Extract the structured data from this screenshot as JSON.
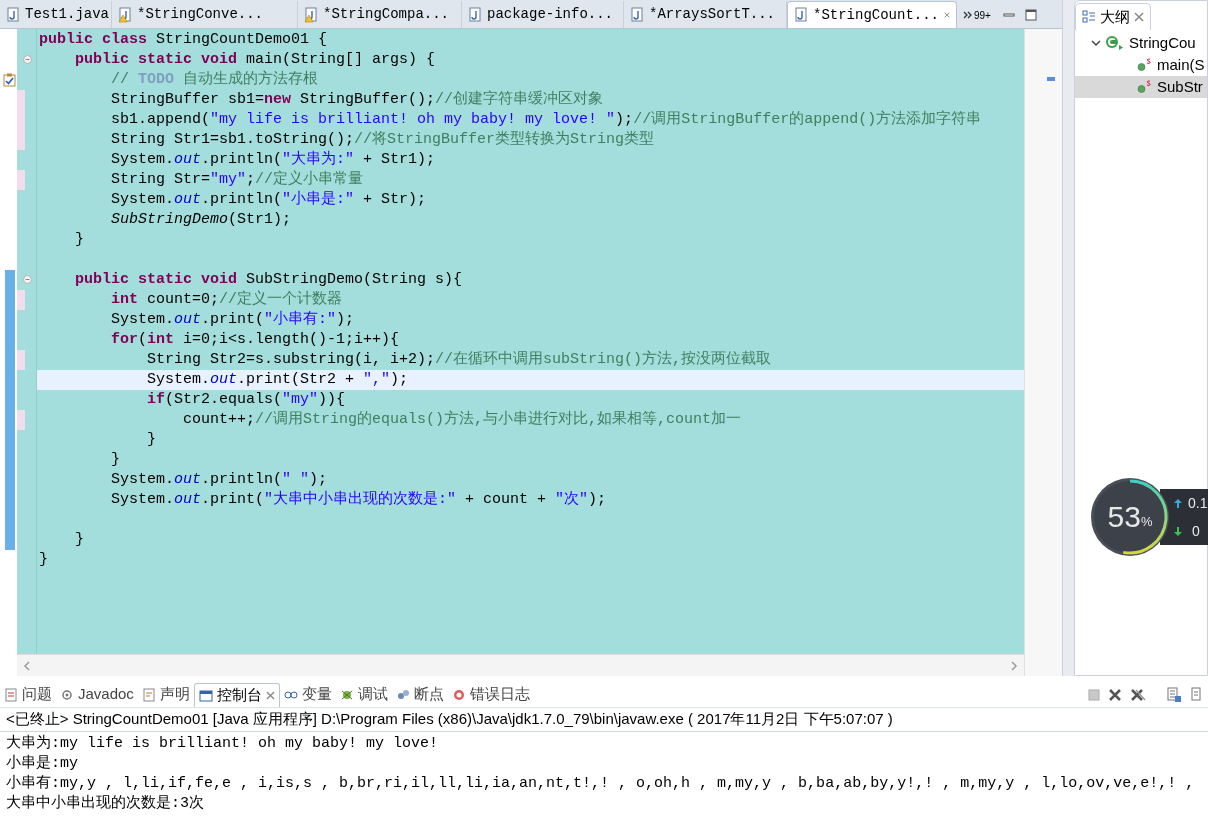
{
  "editor": {
    "tabs": [
      {
        "label": "Test1.java",
        "selected": false,
        "warning": false
      },
      {
        "label": "*StringConve...",
        "selected": false,
        "warning": true
      },
      {
        "label": "*StringCompa...",
        "selected": false,
        "warning": true
      },
      {
        "label": "package-info...",
        "selected": false,
        "warning": false
      },
      {
        "label": "*ArraysSortT...",
        "selected": false,
        "warning": false
      },
      {
        "label": "*StringCount...",
        "selected": true,
        "warning": false
      }
    ],
    "overflow_count": "99+",
    "lines": [
      {
        "tokens": [
          {
            "kind": "keyword",
            "text": "public class"
          },
          {
            "kind": "plain",
            "text": " StringCountDemo01 {"
          }
        ],
        "changed": false,
        "foldable": false,
        "task": false,
        "in_range": false,
        "current": false,
        "children": [
          {
            "tokens": [
              {
                "kind": "keyword",
                "text": "public static void"
              },
              {
                "kind": "plain",
                "text": " main(String[] args) {"
              }
            ],
            "changed": false,
            "foldable": true,
            "task": false,
            "in_range": false,
            "current": false,
            "children": [
              {
                "tokens": [
                  {
                    "kind": "comment",
                    "text": "// "
                  },
                  {
                    "kind": "task_tag",
                    "text": "TODO"
                  },
                  {
                    "kind": "comment",
                    "text": " 自动生成的方法存根"
                  }
                ],
                "changed": false,
                "foldable": false,
                "task": true,
                "in_range": false,
                "current": false
              },
              {
                "tokens": [
                  {
                    "kind": "plain",
                    "text": "StringBuffer sb1="
                  },
                  {
                    "kind": "keyword",
                    "text": "new"
                  },
                  {
                    "kind": "plain",
                    "text": " StringBuffer();"
                  },
                  {
                    "kind": "comment",
                    "text": "//创建字符串缓冲区对象"
                  }
                ],
                "changed": true,
                "foldable": false,
                "task": false,
                "in_range": false,
                "current": false
              },
              {
                "tokens": [
                  {
                    "kind": "plain",
                    "text": "sb1.append("
                  },
                  {
                    "kind": "string",
                    "text": "\"my life is brilliant! oh my baby! my love! \""
                  },
                  {
                    "kind": "plain",
                    "text": ");"
                  },
                  {
                    "kind": "comment",
                    "text": "//调用StringBuffer的append()方法添加字符串"
                  }
                ],
                "changed": true,
                "foldable": false,
                "task": false,
                "in_range": false,
                "current": false
              },
              {
                "tokens": [
                  {
                    "kind": "plain",
                    "text": "String Str1=sb1.toString();"
                  },
                  {
                    "kind": "comment",
                    "text": "//将StringBuffer类型转换为String类型"
                  }
                ],
                "changed": true,
                "foldable": false,
                "task": false,
                "in_range": false,
                "current": false
              },
              {
                "tokens": [
                  {
                    "kind": "plain",
                    "text": "System."
                  },
                  {
                    "kind": "field",
                    "text": "out"
                  },
                  {
                    "kind": "plain",
                    "text": ".println("
                  },
                  {
                    "kind": "string",
                    "text": "\"大串为:\""
                  },
                  {
                    "kind": "plain",
                    "text": " + Str1);"
                  }
                ],
                "changed": false,
                "foldable": false,
                "task": false,
                "in_range": false,
                "current": false
              },
              {
                "tokens": [
                  {
                    "kind": "plain",
                    "text": "String Str="
                  },
                  {
                    "kind": "string",
                    "text": "\"my\""
                  },
                  {
                    "kind": "plain",
                    "text": ";"
                  },
                  {
                    "kind": "comment",
                    "text": "//定义小串常量"
                  }
                ],
                "changed": true,
                "foldable": false,
                "task": false,
                "in_range": false,
                "current": false
              },
              {
                "tokens": [
                  {
                    "kind": "plain",
                    "text": "System."
                  },
                  {
                    "kind": "field",
                    "text": "out"
                  },
                  {
                    "kind": "plain",
                    "text": ".println("
                  },
                  {
                    "kind": "string",
                    "text": "\"小串是:\""
                  },
                  {
                    "kind": "plain",
                    "text": " + Str);"
                  }
                ],
                "changed": false,
                "foldable": false,
                "task": false,
                "in_range": false,
                "current": false
              },
              {
                "tokens": [
                  {
                    "kind": "static_call",
                    "text": "SubStringDemo"
                  },
                  {
                    "kind": "plain",
                    "text": "(Str1);"
                  }
                ],
                "changed": false,
                "foldable": false,
                "task": false,
                "in_range": false,
                "current": false
              }
            ]
          },
          {
            "tokens": [
              {
                "kind": "plain",
                "text": "}"
              }
            ],
            "changed": false,
            "foldable": false,
            "task": false,
            "in_range": false,
            "current": false
          },
          {
            "kind": "blank"
          },
          {
            "tokens": [
              {
                "kind": "keyword",
                "text": "public static void"
              },
              {
                "kind": "plain",
                "text": " SubStringDemo(String s){"
              }
            ],
            "changed": false,
            "foldable": true,
            "task": false,
            "in_range": true,
            "current": false,
            "children": [
              {
                "tokens": [
                  {
                    "kind": "keyword",
                    "text": "int"
                  },
                  {
                    "kind": "plain",
                    "text": " count=0;"
                  },
                  {
                    "kind": "comment",
                    "text": "//定义一个计数器"
                  }
                ],
                "changed": true,
                "foldable": false,
                "task": false,
                "in_range": true,
                "current": false
              },
              {
                "tokens": [
                  {
                    "kind": "plain",
                    "text": "System."
                  },
                  {
                    "kind": "field",
                    "text": "out"
                  },
                  {
                    "kind": "plain",
                    "text": ".print("
                  },
                  {
                    "kind": "string",
                    "text": "\"小串有:\""
                  },
                  {
                    "kind": "plain",
                    "text": ");"
                  }
                ],
                "changed": false,
                "foldable": false,
                "task": false,
                "in_range": true,
                "current": false
              },
              {
                "tokens": [
                  {
                    "kind": "keyword",
                    "text": "for"
                  },
                  {
                    "kind": "plain",
                    "text": "("
                  },
                  {
                    "kind": "keyword",
                    "text": "int"
                  },
                  {
                    "kind": "plain",
                    "text": " i=0;i<s.length()-1;i++){"
                  }
                ],
                "changed": false,
                "foldable": false,
                "task": false,
                "in_range": true,
                "current": false,
                "children": [
                  {
                    "tokens": [
                      {
                        "kind": "plain",
                        "text": "String Str2=s.substring(i, i+2);"
                      },
                      {
                        "kind": "comment",
                        "text": "//在循环中调用subString()方法,按没两位截取"
                      }
                    ],
                    "changed": true,
                    "foldable": false,
                    "task": false,
                    "in_range": true,
                    "current": false
                  },
                  {
                    "tokens": [
                      {
                        "kind": "plain",
                        "text": "System."
                      },
                      {
                        "kind": "field",
                        "text": "out"
                      },
                      {
                        "kind": "plain",
                        "text": ".print(Str2 + "
                      },
                      {
                        "kind": "string",
                        "text": "\",\""
                      },
                      {
                        "kind": "plain",
                        "text": ");"
                      }
                    ],
                    "changed": false,
                    "foldable": false,
                    "task": false,
                    "in_range": true,
                    "current": true
                  },
                  {
                    "tokens": [
                      {
                        "kind": "keyword",
                        "text": "if"
                      },
                      {
                        "kind": "plain",
                        "text": "(Str2.equals("
                      },
                      {
                        "kind": "string",
                        "text": "\"my\""
                      },
                      {
                        "kind": "plain",
                        "text": ")){"
                      }
                    ],
                    "changed": false,
                    "foldable": false,
                    "task": false,
                    "in_range": true,
                    "current": false,
                    "children": [
                      {
                        "tokens": [
                          {
                            "kind": "plain",
                            "text": "count++;"
                          },
                          {
                            "kind": "comment",
                            "text": "//调用String的equals()方法,与小串进行对比,如果相等,count加一"
                          }
                        ],
                        "changed": true,
                        "foldable": false,
                        "task": false,
                        "in_range": true,
                        "current": false
                      }
                    ]
                  },
                  {
                    "tokens": [
                      {
                        "kind": "plain",
                        "text": "}"
                      }
                    ],
                    "changed": false,
                    "foldable": false,
                    "task": false,
                    "in_range": true,
                    "current": false
                  }
                ]
              },
              {
                "tokens": [
                  {
                    "kind": "plain",
                    "text": "}"
                  }
                ],
                "changed": false,
                "foldable": false,
                "task": false,
                "in_range": true,
                "current": false
              },
              {
                "tokens": [
                  {
                    "kind": "plain",
                    "text": "System."
                  },
                  {
                    "kind": "field",
                    "text": "out"
                  },
                  {
                    "kind": "plain",
                    "text": ".println("
                  },
                  {
                    "kind": "string",
                    "text": "\" \""
                  },
                  {
                    "kind": "plain",
                    "text": ");"
                  }
                ],
                "changed": false,
                "foldable": false,
                "task": false,
                "in_range": true,
                "current": false
              },
              {
                "tokens": [
                  {
                    "kind": "plain",
                    "text": "System."
                  },
                  {
                    "kind": "field",
                    "text": "out"
                  },
                  {
                    "kind": "plain",
                    "text": ".print("
                  },
                  {
                    "kind": "string",
                    "text": "\"大串中小串出现的次数是:\""
                  },
                  {
                    "kind": "plain",
                    "text": " + count + "
                  },
                  {
                    "kind": "string",
                    "text": "\"次\""
                  },
                  {
                    "kind": "plain",
                    "text": ");"
                  }
                ],
                "changed": false,
                "foldable": false,
                "task": false,
                "in_range": true,
                "current": false
              },
              {
                "kind": "blank"
              }
            ]
          },
          {
            "tokens": [
              {
                "kind": "plain",
                "text": "}"
              }
            ],
            "changed": false,
            "foldable": false,
            "task": false,
            "in_range": true,
            "current": false
          }
        ]
      },
      {
        "tokens": [
          {
            "kind": "plain",
            "text": "}"
          }
        ],
        "changed": false,
        "foldable": false,
        "task": false,
        "in_range": false,
        "current": false
      }
    ]
  },
  "outline": {
    "title": "大纲",
    "tree": [
      {
        "label": "StringCou",
        "kind": "class",
        "expanded": true,
        "selected": false,
        "children": [
          {
            "label": "main(S",
            "kind": "method",
            "selected": false
          },
          {
            "label": "SubStr",
            "kind": "method",
            "selected": true
          }
        ]
      }
    ]
  },
  "console": {
    "tabs": [
      {
        "label": "问题",
        "selected": false
      },
      {
        "label": "Javadoc",
        "selected": false
      },
      {
        "label": "声明",
        "selected": false
      },
      {
        "label": "控制台",
        "selected": true
      },
      {
        "label": "变量",
        "selected": false
      },
      {
        "label": "调试",
        "selected": false
      },
      {
        "label": "断点",
        "selected": false
      },
      {
        "label": "错误日志",
        "selected": false
      }
    ],
    "header": "<已终止> StringCountDemo01 [Java 应用程序] D:\\Program Files (x86)\\Java\\jdk1.7.0_79\\bin\\javaw.exe ( 2017年11月2日 下午5:07:07 )",
    "output": [
      "大串为:my life is brilliant! oh my baby! my love!",
      "小串是:my",
      "小串有:my,y , l,li,if,fe,e , i,is,s , b,br,ri,il,ll,li,ia,an,nt,t!,! , o,oh,h , m,my,y , b,ba,ab,by,y!,! , m,my,y , l,lo,ov,ve,e!,! ,",
      "大串中小串出现的次数是:3次"
    ]
  },
  "meter": {
    "percent": "53",
    "unit": "%",
    "upload": "0.1",
    "download": "0"
  }
}
